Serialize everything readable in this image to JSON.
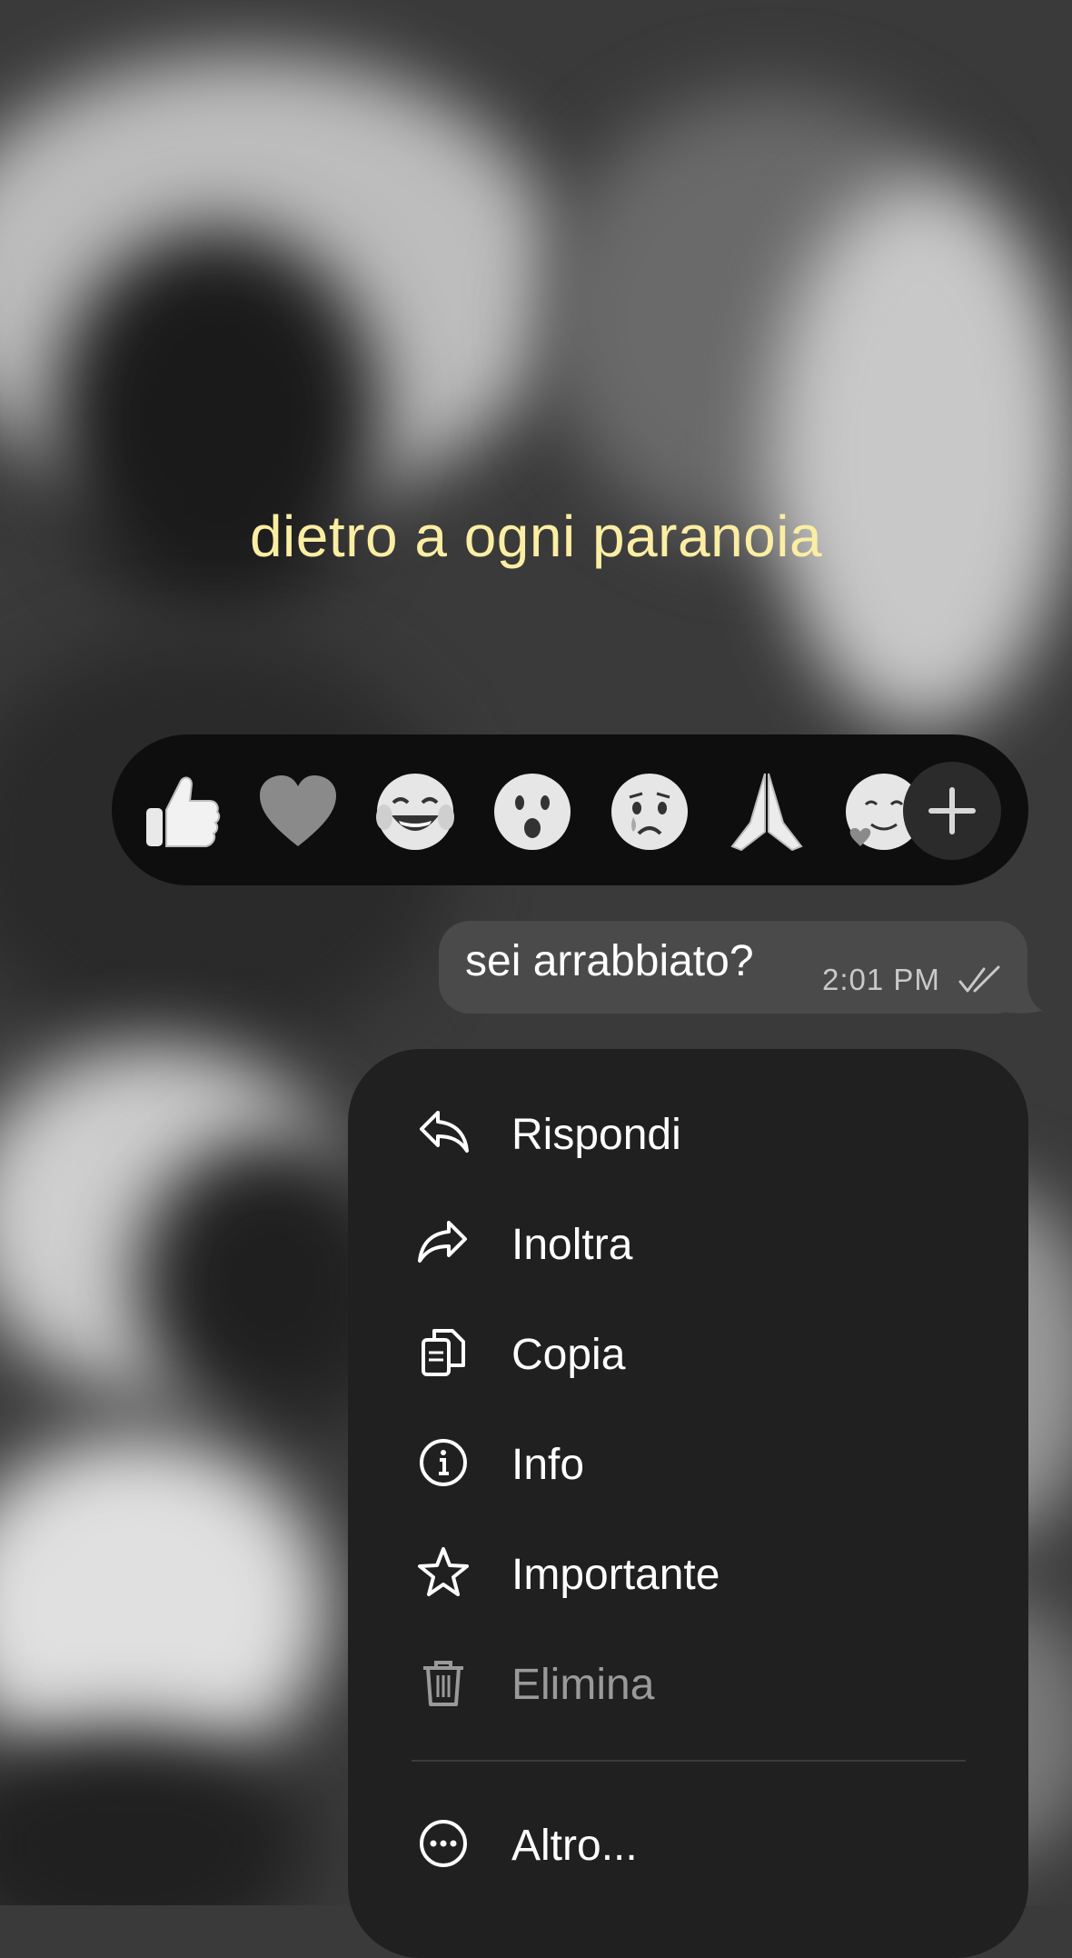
{
  "caption": "dietro a ogni paranoia",
  "reactions": {
    "emojis": [
      "thumbs-up",
      "heart",
      "tears-of-joy",
      "surprised",
      "crying",
      "folded-hands",
      "smiling-with-heart"
    ],
    "plus_icon": "plus-icon"
  },
  "message": {
    "text": "sei arrabbiato?",
    "time": "2:01 PM",
    "status_icon": "double-check-icon"
  },
  "menu": {
    "items": [
      {
        "label": "Rispondi",
        "icon": "reply-icon"
      },
      {
        "label": "Inoltra",
        "icon": "forward-icon"
      },
      {
        "label": "Copia",
        "icon": "copy-icon"
      },
      {
        "label": "Info",
        "icon": "info-icon"
      },
      {
        "label": "Importante",
        "icon": "star-icon"
      },
      {
        "label": "Elimina",
        "icon": "trash-icon"
      },
      {
        "label": "Altro...",
        "icon": "more-icon"
      }
    ]
  },
  "colors": {
    "caption": "#fbeea3",
    "bubble": "#4a4a4a",
    "menu_bg": "#202020",
    "muted_label": "#9a9a9a"
  }
}
